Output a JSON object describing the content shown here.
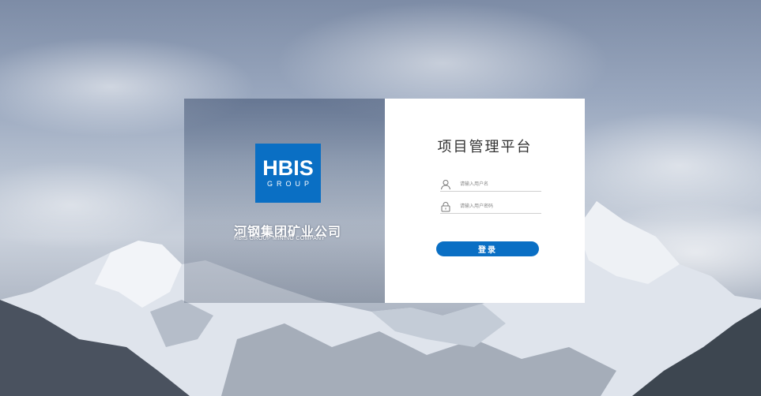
{
  "logo": {
    "main": "HBIS",
    "sub": "GROUP"
  },
  "company": {
    "name_cn": "河钢集团矿业公司",
    "name_en": "HBIS GROUP MINING COMPANY"
  },
  "login": {
    "title": "项目管理平台",
    "username_placeholder": "请输入用户名",
    "password_placeholder": "请输入用户密码",
    "submit_label": "登录"
  },
  "colors": {
    "brand_blue": "#0a6fc4"
  }
}
